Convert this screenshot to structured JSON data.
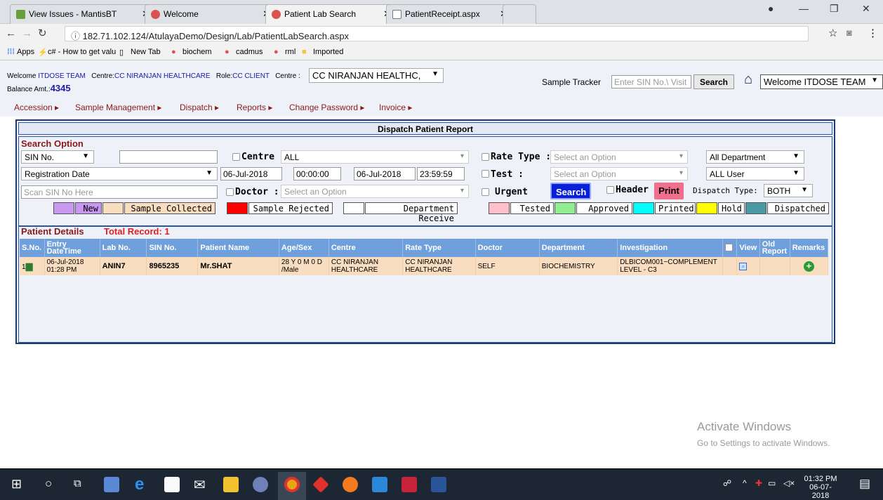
{
  "browser": {
    "tabs": [
      {
        "title": "View Issues - MantisBT",
        "active": false
      },
      {
        "title": "Welcome",
        "active": false
      },
      {
        "title": "Patient Lab Search",
        "active": true
      },
      {
        "title": "PatientReceipt.aspx",
        "active": false
      }
    ],
    "url": "182.71.102.124/AtulayaDemo/Design/Lab/PatientLabSearch.aspx",
    "bookmarks": [
      "Apps",
      "c# - How to get valu",
      "New Tab",
      "biochem",
      "cadmus",
      "rml",
      "Imported"
    ]
  },
  "header": {
    "welcome_label": "Welcome",
    "welcome_user": "ITDOSE TEAM",
    "centre_label": "Centre:",
    "centre_value": "CC NIRANJAN HEALTHCARE",
    "role_label": "Role:",
    "role_value": "CC CLIENT",
    "centre_select_label": "Centre :",
    "centre_select_value": "CC NIRANJAN HEALTHC,",
    "balance_label": "Balance Amt.:",
    "balance_value": "4345",
    "sample_tracker_label": "Sample Tracker",
    "sample_tracker_placeholder": "Enter SIN No.\\ Visit",
    "search_button": "Search",
    "user_select": "Welcome ITDOSE TEAM"
  },
  "menu": [
    "Accession",
    "Sample Management",
    "Dispatch",
    "Reports",
    "Change Password",
    "Invoice"
  ],
  "panel": {
    "title": "Dispatch Patient Report",
    "search_option_label": "Search Option",
    "sin_select": "SIN No.",
    "centre_label": "Centre :",
    "centre_value": "ALL",
    "rate_type_label": "Rate Type :",
    "rate_type_placeholder": "Select an Option",
    "department_select": "All Department",
    "date_type_select": "Registration Date",
    "from_date": "06-Jul-2018",
    "from_time": "00:00:00",
    "to_date": "06-Jul-2018",
    "to_time": "23:59:59",
    "test_label": "Test :",
    "test_placeholder": "Select an Option",
    "user_select": "ALL User",
    "scan_placeholder": "Scan SIN No Here",
    "doctor_label": "Doctor :",
    "doctor_placeholder": "Select an Option",
    "urgent_label": "Urgent",
    "search_button": "Search",
    "header_label": "Header",
    "print_button": "Print",
    "dispatch_type_label": "Dispatch Type:",
    "dispatch_type_value": "BOTH"
  },
  "legend": [
    {
      "label": "New",
      "color": "#c897f0"
    },
    {
      "label": "Sample Collected",
      "color": "#f8ddc0"
    },
    {
      "label": "Sample Rejected",
      "color": "#ff0000"
    },
    {
      "label": "Department Receive",
      "color": "#ffffff"
    },
    {
      "label": "Tested",
      "color": "#ffc0cb"
    },
    {
      "label": "Approved",
      "color": "#90ee90"
    },
    {
      "label": "Printed",
      "color": "#00ffff"
    },
    {
      "label": "Hold",
      "color": "#ffff00"
    },
    {
      "label": "Dispatched",
      "color": "#4a9aa5"
    }
  ],
  "patient_details": {
    "label": "Patient Details",
    "total_label": "Total Record: 1",
    "columns": [
      "S.No.",
      "Entry DateTime",
      "Lab No.",
      "SIN No.",
      "Patient Name",
      "Age/Sex",
      "Centre",
      "Rate Type",
      "Doctor",
      "Department",
      "Investigation",
      "",
      "View",
      "Old Report",
      "Remarks"
    ],
    "rows": [
      {
        "sno": "1",
        "entry_date": "06-Jul-2018",
        "entry_time": "01:28 PM",
        "lab_no": "ANIN7",
        "sin_no": "8965235",
        "patient_name": "Mr.SHAT",
        "age_sex_1": "28 Y 0 M 0 D",
        "age_sex_2": "/Male",
        "centre_1": "CC NIRANJAN",
        "centre_2": "HEALTHCARE",
        "rate_1": "CC NIRANJAN",
        "rate_2": "HEALTHCARE",
        "doctor": "SELF",
        "department": "BIOCHEMISTRY",
        "investigation_1": "DLBICOM001~COMPLEMENT",
        "investigation_2": "LEVEL - C3"
      }
    ]
  },
  "watermark": {
    "line1": "Activate Windows",
    "line2": "Go to Settings to activate Windows."
  },
  "taskbar": {
    "time": "01:32 PM",
    "date": "06-07-2018"
  }
}
